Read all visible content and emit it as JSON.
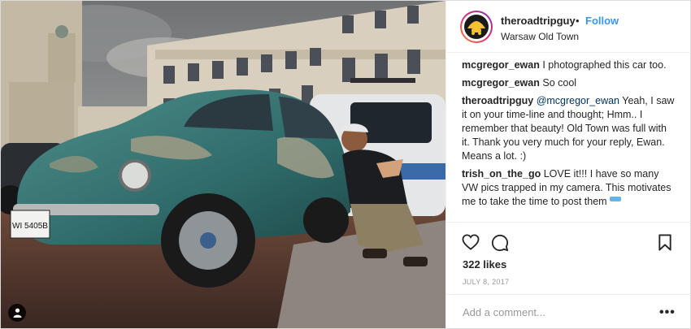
{
  "post": {
    "username": "theroadtripguy",
    "separator": "•",
    "follow_label": "Follow",
    "location": "Warsaw Old Town",
    "likes": "322 likes",
    "date": "JULY 8, 2017",
    "comment_placeholder": "Add a comment...",
    "more_label": "•••",
    "photo": {
      "car_plate": "WI 5405B"
    }
  },
  "comments": [
    {
      "user": "mcgregor_ewan",
      "text": "I photographed this car too."
    },
    {
      "user": "mcgregor_ewan",
      "text": "So cool"
    },
    {
      "user": "theroadtripguy",
      "mention": "@mcgregor_ewan",
      "text": "Yeah, I saw it on your time-line and thought; Hmm.. I remember that beauty! Old Town was full with it. Thank you very much for your reply, Ewan. Means a lot. :)"
    },
    {
      "user": "trish_on_the_go",
      "text": "LOVE it!!! I have so many VW pics trapped in my camera. This motivates me to take the time to post them"
    }
  ],
  "icons": {
    "like": "heart-icon",
    "comment": "comment-bubble-icon",
    "save": "bookmark-icon",
    "tag": "user-tag-icon"
  },
  "colors": {
    "accent": "#3897f0",
    "text": "#262626",
    "muted": "#999999",
    "border": "#efefef"
  }
}
